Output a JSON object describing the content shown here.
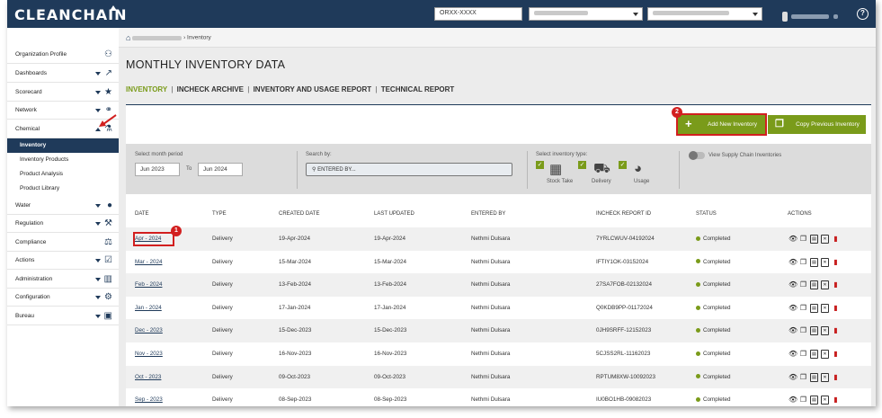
{
  "app": {
    "logo": "CLEANCHAIN"
  },
  "topbar": {
    "org_input": "ORXX-XXXX",
    "help": "?"
  },
  "sidebar": {
    "items": [
      {
        "label": "Organization Profile",
        "icon": "sitemap-icon",
        "glyph": "⚇"
      },
      {
        "label": "Dashboards",
        "icon": "line-chart-icon",
        "glyph": "📈"
      },
      {
        "label": "Scorecard",
        "icon": "star-icon",
        "glyph": "★"
      },
      {
        "label": "Network",
        "icon": "link-icon",
        "glyph": "⚭"
      },
      {
        "label": "Chemical",
        "icon": "flask-icon",
        "glyph": "⚗"
      },
      {
        "label": "Water",
        "icon": "drop-icon",
        "glyph": "💧"
      },
      {
        "label": "Regulation",
        "icon": "gavel-icon",
        "glyph": "⚒"
      },
      {
        "label": "Compliance",
        "icon": "scale-icon",
        "glyph": "⚖"
      },
      {
        "label": "Actions",
        "icon": "check-square-icon",
        "glyph": "☑"
      },
      {
        "label": "Administration",
        "icon": "bank-icon",
        "glyph": "🏛"
      },
      {
        "label": "Configuration",
        "icon": "gears-icon",
        "glyph": "⚙"
      },
      {
        "label": "Bureau",
        "icon": "briefcase-icon",
        "glyph": "💼"
      }
    ],
    "chemical_sub": [
      "Inventory",
      "Inventory Products",
      "Product Analysis",
      "Product Library"
    ]
  },
  "breadcrumb": {
    "current": "Inventory"
  },
  "page": {
    "title": "MONTHLY INVENTORY DATA"
  },
  "subnav": {
    "tab1": "INVENTORY",
    "tab2": "INCHECK ARCHIVE",
    "tab3": "INVENTORY AND USAGE REPORT",
    "tab4": "TECHNICAL REPORT",
    "sep": "|"
  },
  "buttons": {
    "add": "Add New Inventory",
    "copy": "Copy Previous Inventory",
    "badge1": "1",
    "badge2": "2"
  },
  "filters": {
    "month_label": "Select month period",
    "from": "Jun 2023",
    "to_label": "To",
    "to": "Jun 2024",
    "search_label": "Search by:",
    "search_placeholder": "ENTERED BY...",
    "type_label": "Select inventory type:",
    "type_stock": "Stock Take",
    "type_delivery": "Delivery",
    "type_usage": "Usage",
    "supply_toggle": "View Supply Chain Inventories"
  },
  "table": {
    "headers": [
      "DATE",
      "TYPE",
      "CREATED DATE",
      "LAST UPDATED",
      "ENTERED BY",
      "INCHECK REPORT ID",
      "STATUS",
      "ACTIONS"
    ],
    "rows": [
      {
        "date": "Apr - 2024",
        "type": "Delivery",
        "created": "19-Apr-2024",
        "updated": "19-Apr-2024",
        "by": "Nethmi Dulsara",
        "report": "7YRLCWUV-04192024",
        "status": "Completed"
      },
      {
        "date": "Mar - 2024",
        "type": "Delivery",
        "created": "15-Mar-2024",
        "updated": "15-Mar-2024",
        "by": "Nethmi Dulsara",
        "report": "IFTIY1OK-03152024",
        "status": "Completed"
      },
      {
        "date": "Feb - 2024",
        "type": "Delivery",
        "created": "13-Feb-2024",
        "updated": "13-Feb-2024",
        "by": "Nethmi Dulsara",
        "report": "27SA7FOB-02132024",
        "status": "Completed"
      },
      {
        "date": "Jan - 2024",
        "type": "Delivery",
        "created": "17-Jan-2024",
        "updated": "17-Jan-2024",
        "by": "Nethmi Dulsara",
        "report": "Q0KDB9PP-01172024",
        "status": "Completed"
      },
      {
        "date": "Dec - 2023",
        "type": "Delivery",
        "created": "15-Dec-2023",
        "updated": "15-Dec-2023",
        "by": "Nethmi Dulsara",
        "report": "0JH9SRFF-12152023",
        "status": "Completed"
      },
      {
        "date": "Nov - 2023",
        "type": "Delivery",
        "created": "16-Nov-2023",
        "updated": "16-Nov-2023",
        "by": "Nethmi Dulsara",
        "report": "5CJSS2RL-11162023",
        "status": "Completed"
      },
      {
        "date": "Oct - 2023",
        "type": "Delivery",
        "created": "09-Oct-2023",
        "updated": "09-Oct-2023",
        "by": "Nethmi Dulsara",
        "report": "RPTUM8XW-10092023",
        "status": "Completed"
      },
      {
        "date": "Sep - 2023",
        "type": "Delivery",
        "created": "08-Sep-2023",
        "updated": "08-Sep-2023",
        "by": "Nethmi Dulsara",
        "report": "IU0BO1HB-09082023",
        "status": "Completed"
      }
    ]
  },
  "colors": {
    "navy": "#1f3a5a",
    "green": "#7a9b1a",
    "red": "#d21f1f"
  }
}
